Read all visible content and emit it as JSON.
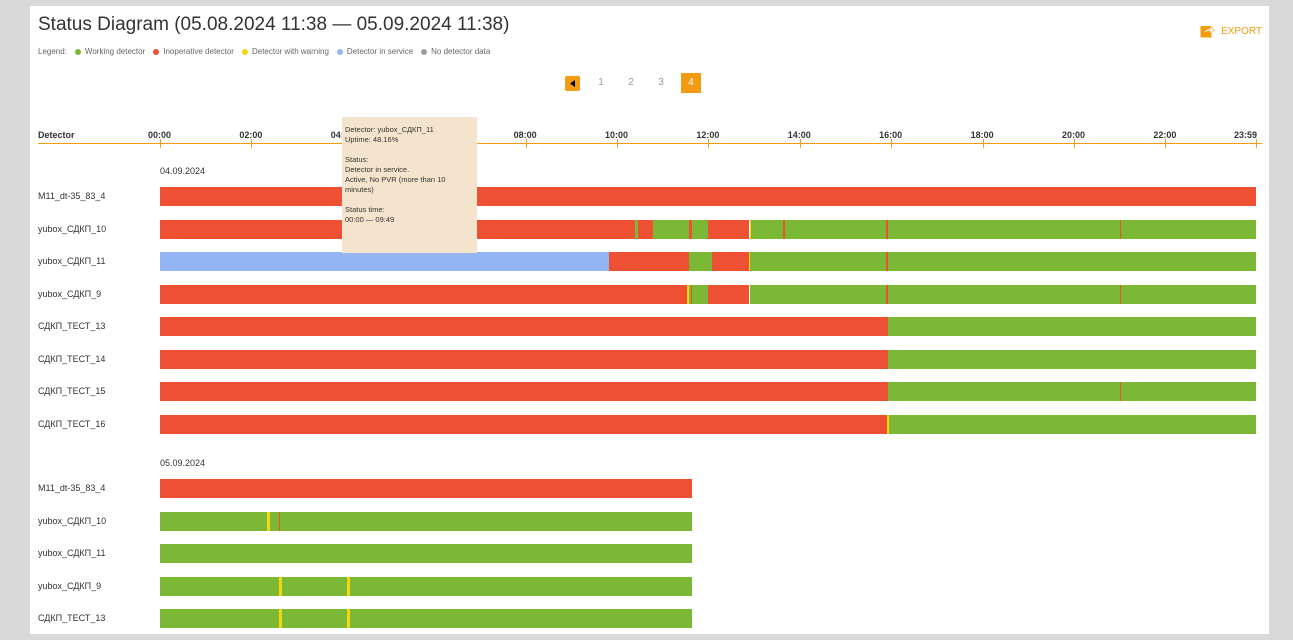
{
  "title": "Status Diagram (05.08.2024 11:38 — 05.09.2024 11:38)",
  "legend": {
    "label": "Legend:",
    "items": [
      {
        "label": "Working detector",
        "color": "#7ab836"
      },
      {
        "label": "Inoperative detector",
        "color": "#ee5034"
      },
      {
        "label": "Detector with warning",
        "color": "#f5d60f"
      },
      {
        "label": "Detector in service",
        "color": "#94b6f5"
      },
      {
        "label": "No detector data",
        "color": "#9e9e9e"
      }
    ]
  },
  "export_label": "EXPORT",
  "pagination": {
    "pages": [
      "1",
      "2",
      "3",
      "4"
    ],
    "current": "4"
  },
  "axis": {
    "label": "Detector",
    "ticks": [
      "00:00",
      "02:00",
      "04:00",
      "06:00",
      "08:00",
      "10:00",
      "12:00",
      "14:00",
      "16:00",
      "18:00",
      "20:00",
      "22:00",
      "23:59"
    ]
  },
  "colors": {
    "working": "#7ab836",
    "inoperative": "#ee5034",
    "warning": "#f5d60f",
    "service": "#94b6f5",
    "nodata": "#9e9e9e",
    "accent": "#f39c12"
  },
  "days": [
    {
      "date": "04.09.2024",
      "rows": [
        {
          "name": "M11_dt-35_83_4",
          "segments": [
            [
              "inoperative",
              "00:00",
              "23:59"
            ]
          ]
        },
        {
          "name": "yubox_СДКП_10",
          "segments": [
            [
              "inoperative",
              "00:00",
              "10:24"
            ],
            [
              "working",
              "10:24",
              "10:28"
            ],
            [
              "inoperative",
              "10:28",
              "10:47"
            ],
            [
              "working",
              "10:47",
              "11:35"
            ],
            [
              "inoperative",
              "11:35",
              "11:39"
            ],
            [
              "working",
              "11:39",
              "11:59"
            ],
            [
              "inoperative",
              "11:59",
              "12:54"
            ],
            [
              "warning",
              "12:54",
              "12:56"
            ],
            [
              "working",
              "12:56",
              "13:38"
            ],
            [
              "inoperative",
              "13:38",
              "13:40"
            ],
            [
              "working",
              "13:40",
              "15:53"
            ],
            [
              "inoperative",
              "15:53",
              "15:56"
            ],
            [
              "working",
              "15:56",
              "21:00"
            ],
            [
              "inoperative",
              "21:00",
              "21:02"
            ],
            [
              "working",
              "21:02",
              "23:59"
            ]
          ]
        },
        {
          "name": "yubox_СДКП_11",
          "segments": [
            [
              "service",
              "00:00",
              "09:49"
            ],
            [
              "inoperative",
              "09:49",
              "11:34"
            ],
            [
              "working",
              "11:34",
              "12:05"
            ],
            [
              "inoperative",
              "12:05",
              "12:53"
            ],
            [
              "warning",
              "12:53",
              "12:55"
            ],
            [
              "working",
              "12:55",
              "15:53"
            ],
            [
              "inoperative",
              "15:53",
              "15:56"
            ],
            [
              "working",
              "15:56",
              "23:59"
            ]
          ]
        },
        {
          "name": "yubox_СДКП_9",
          "segments": [
            [
              "inoperative",
              "00:00",
              "11:32"
            ],
            [
              "warning",
              "11:32",
              "11:34"
            ],
            [
              "working",
              "11:34",
              "11:37"
            ],
            [
              "inoperative",
              "11:37",
              "11:39"
            ],
            [
              "working",
              "11:39",
              "11:59"
            ],
            [
              "inoperative",
              "11:59",
              "12:54"
            ],
            [
              "working",
              "12:54",
              "15:53"
            ],
            [
              "inoperative",
              "15:53",
              "15:56"
            ],
            [
              "working",
              "15:56",
              "21:00"
            ],
            [
              "inoperative",
              "21:00",
              "21:02"
            ],
            [
              "working",
              "21:02",
              "23:59"
            ]
          ]
        },
        {
          "name": "СДКП_ТЕСТ_13",
          "segments": [
            [
              "inoperative",
              "00:00",
              "15:56"
            ],
            [
              "working",
              "15:56",
              "23:59"
            ]
          ]
        },
        {
          "name": "СДКП_ТЕСТ_14",
          "segments": [
            [
              "inoperative",
              "00:00",
              "15:56"
            ],
            [
              "working",
              "15:56",
              "23:59"
            ]
          ]
        },
        {
          "name": "СДКП_ТЕСТ_15",
          "segments": [
            [
              "inoperative",
              "00:00",
              "15:56"
            ],
            [
              "working",
              "15:56",
              "21:00"
            ],
            [
              "inoperative",
              "21:00",
              "21:02"
            ],
            [
              "working",
              "21:02",
              "23:59"
            ]
          ]
        },
        {
          "name": "СДКП_ТЕСТ_16",
          "segments": [
            [
              "inoperative",
              "00:00",
              "15:55"
            ],
            [
              "warning",
              "15:55",
              "15:57"
            ],
            [
              "working",
              "15:57",
              "23:59"
            ]
          ]
        }
      ]
    },
    {
      "date": "05.09.2024",
      "rows": [
        {
          "name": "M11_dt-35_83_4",
          "segments": [
            [
              "inoperative",
              "00:00",
              "11:38"
            ]
          ]
        },
        {
          "name": "yubox_СДКП_10",
          "segments": [
            [
              "working",
              "00:00",
              "02:20"
            ],
            [
              "warning",
              "02:20",
              "02:24"
            ],
            [
              "working",
              "02:24",
              "02:36"
            ],
            [
              "inoperative",
              "02:36",
              "02:38"
            ],
            [
              "working",
              "02:38",
              "11:38"
            ]
          ]
        },
        {
          "name": "yubox_СДКП_11",
          "segments": [
            [
              "working",
              "00:00",
              "11:38"
            ]
          ]
        },
        {
          "name": "yubox_СДКП_9",
          "segments": [
            [
              "working",
              "00:00",
              "02:36"
            ],
            [
              "warning",
              "02:36",
              "02:40"
            ],
            [
              "working",
              "02:40",
              "04:06"
            ],
            [
              "warning",
              "04:06",
              "04:10"
            ],
            [
              "working",
              "04:10",
              "11:38"
            ]
          ]
        },
        {
          "name": "СДКП_ТЕСТ_13",
          "segments": [
            [
              "working",
              "00:00",
              "02:36"
            ],
            [
              "warning",
              "02:36",
              "02:40"
            ],
            [
              "working",
              "02:40",
              "04:06"
            ],
            [
              "warning",
              "04:06",
              "04:10"
            ],
            [
              "working",
              "04:10",
              "11:38"
            ]
          ]
        }
      ]
    }
  ],
  "tooltip": {
    "line1": "Detector: yubox_СДКП_11",
    "line2": "Uptime: 48.16%",
    "status_label": "Status:",
    "status1": "Detector in service.",
    "status2": "Active, No PVR (more than 10 minutes)",
    "time_label": "Status time:",
    "time_value": "00:00 — 09:49"
  }
}
